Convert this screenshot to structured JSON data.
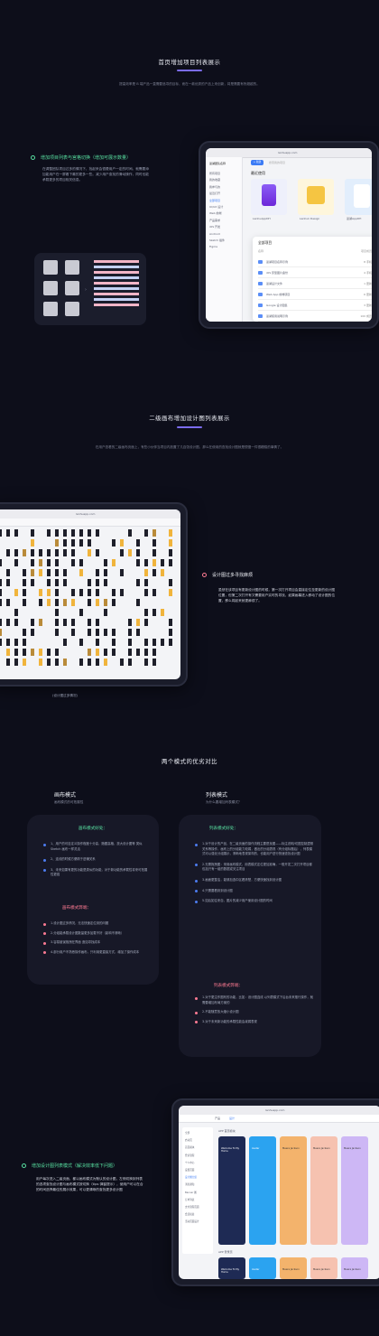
{
  "section1": {
    "title": "首页增加项目列表展示",
    "desc": "提高效率是 B 端产品一直需要追寻的目标，而在一款优秀的产品上来创新，将是需要有所超越的。"
  },
  "feature1": {
    "heading": "增加项目列表与宫格切换（增加可展示数量）",
    "desc": "在调整团队项目过多的情况下，找起来会很费用户一定的时间。就需要添加能用户在一屏看下最的更多一些。减少用户查找的滑动操作，同时也能承载更多的项目相关信息。"
  },
  "app1": {
    "url": "lanhuapp.com",
    "brand": "蓝湖团队名称",
    "new_button": "+ 新建",
    "search_placeholder": "搜索我的项目",
    "sidebar": [
      "所有项目",
      "我的收藏",
      "我参与的",
      "最近打开",
      "全部项目",
      "UI/UX 设计",
      "Web 前端",
      "产品需求",
      "iOS 开发",
      "Android",
      "Sketch 插件",
      "Figma"
    ],
    "recent_title": "最近使用",
    "recent_cards": [
      {
        "name": "LanhuAppDH",
        "sub": "3天前"
      },
      {
        "name": "Lanhuk Design",
        "sub": "5天前"
      },
      {
        "name": "蓝湖AppDH",
        "sub": "1周前"
      }
    ],
    "list_title": "全部项目",
    "list_cols": [
      "名称",
      "项目成员"
    ],
    "list_rows": [
      {
        "name": "蓝湖项目名称示例",
        "meta": "8 手机"
      },
      {
        "name": "iOS 原型图片备份",
        "meta": "4 手机"
      },
      {
        "name": "蓝湖设计文件",
        "meta": "1 更新"
      },
      {
        "name": "Web App 前端项目",
        "meta": "6 更新"
      },
      {
        "name": "Google 设计图集",
        "meta": "3 更新"
      },
      {
        "name": "蓝湖使用说明示例",
        "meta": "100 成员"
      }
    ]
  },
  "section2": {
    "title": "二级画布增加设计图列表展示",
    "desc": "在用户查看的二级画布页面上，有些小伙伴当项目内放置了几百张设计图，那么在使用的查找设计图就是很慢一件很糟糕的事情了。"
  },
  "feature2": {
    "heading": "设计图过多寻找麻烦",
    "desc": "虽然在该项目有更新设计图的时候，第一次打开项目会直接定位至更新的设计图位置，但第二次打开有又需要用户实时的寻找，如果画幕进入移动了设计图的位置，那么将起来就更麻烦了。"
  },
  "app2": {
    "url": "lanhuapp.com",
    "caption": "(设计图过多情况)"
  },
  "section3": {
    "title": "两个模式的优劣对比"
  },
  "canvas_mode": {
    "title": "画布模式",
    "subtitle": "画布模式的可拓展性",
    "pros_head": "画布模式好处：",
    "pros": [
      "1、用户的可自定义操作程度十分高，随图高格，放大设计图等 类似 Sketch 画布一样灵活",
      "2、连线的时候方便精于进辅关系",
      "3、未来如果有更的功能是类似的功能，对于新功能的承载性将来可拓展性更强"
    ],
    "cons_head": "画布模式弊端：",
    "cons": [
      "1.设计图过多情况，无法快速定位到的问题",
      "2.分组能承载设计图数量更多加载不好（影响不清晰）",
      "3.容易被误拖拽在界面 造如寻找成本",
      "4.部分用户不熟悉操作画布，只利用更直接方式，增加了操作成本"
    ]
  },
  "list_mode": {
    "title": "列表模式",
    "subtitle": "为什么要增加列表模式？",
    "pros_head": "列表模式好处：",
    "pros": [
      "1.对于设计的产品，在二级页面的操作流程主要是找图——标注说明/切图控制逻辑关系等操作，画布上的分组能力较弱，做出的分组表现（有分组标题后），列表模式可以强化分组展示，清晰地表现架构的，也能用户进行快速查找设计图",
      "2.无需拖拽图：采用画布模式，用表模式定位更加准确，一般开发二次打开项目都包括只有一组的数据或关注项目",
      "3.画面更整洁，能够加选中区看清楚，方便快速找到设计图",
      "4.只需要看到到设计图",
      "5.如后如往来自，图片的减少用户使用设计图的时间"
    ],
    "cons_head": "列表模式弊端：",
    "cons": [
      "1.对于更注作图布的功能，比如：设计图连线 以列表模式下后台未来推行操作，就需要增加布局方案的",
      "2.不能随意放大缩小设计图",
      "3.对于未来新功能的承载性能会减弱表现"
    ]
  },
  "feature3": {
    "heading": "增加设计图列表模式（解决效率低下问题）",
    "desc": "用户每次进入二级页面，都以画布模式为默认的设计图，左侧切换到列表的选项查找设计图与画布模式按切换（tips 弹窗提示），使用户可以在合的时间选择最佳的展示效果，可以更清晰的查找更多设计图"
  },
  "app3": {
    "url": "lanhuapp.com",
    "tabs": [
      "产品",
      "设计"
    ],
    "sidebar": [
      "全部",
      "启动页",
      "首页模块",
      "登录流程",
      "个人中心",
      "设置页面",
      "设计图分组",
      "消息通知",
      "Banner 图",
      "订单列表",
      "支付流程页面",
      "会员权益",
      "活动页面设计"
    ],
    "group1": "APP 首页模块",
    "group2": "APP 登录页",
    "cards": [
      {
        "name": "Welcome To My Home",
        "color": "#1e2a54"
      },
      {
        "name": "Avatar",
        "color": "#2ba3f0"
      },
      {
        "name": "Meera Jackson",
        "color": "#f3b36c"
      },
      {
        "name": "Meera Jackson",
        "color": "#f6c2b0"
      },
      {
        "name": "Meera Jackson",
        "color": "#cdb7f5"
      }
    ]
  },
  "colors": {
    "accent": "#7b6cf0",
    "green": "#58e0a1",
    "pink": "#ff7b93",
    "bg": "#0d0e1a"
  }
}
